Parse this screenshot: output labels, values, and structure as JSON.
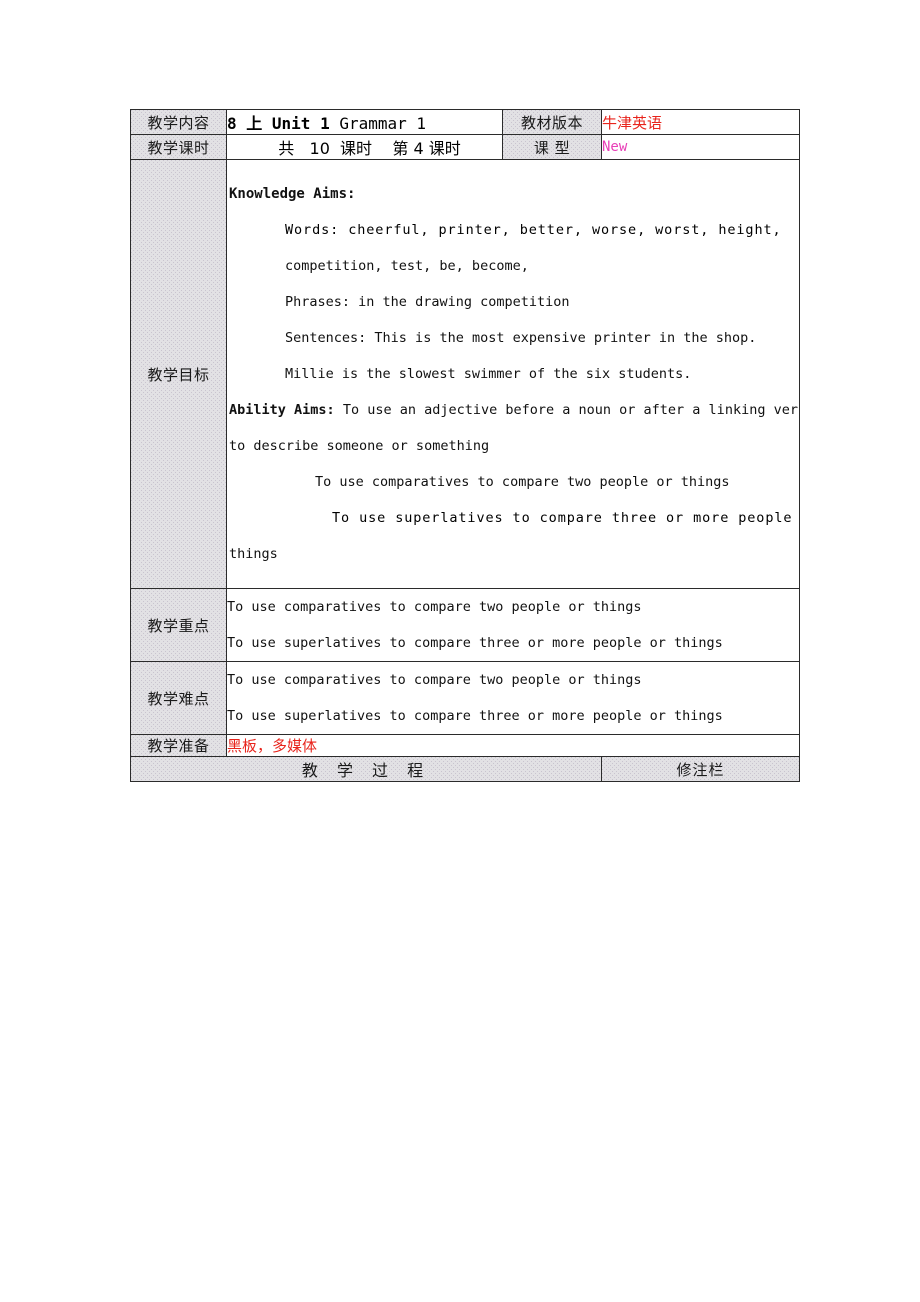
{
  "document": {
    "type": "lesson-plan-table"
  },
  "colors": {
    "shade": "#e2e1e4",
    "border": "#2b2b2b",
    "red": "#e8241c",
    "magenta": "#e83fb7"
  },
  "rows": {
    "content": {
      "label": "教学内容",
      "value_strong": "8 上 Unit 1 ",
      "value_plain": "Grammar 1",
      "textbook_label": "教材版本",
      "textbook_value": "牛津英语"
    },
    "periods": {
      "label": "教学课时",
      "value": "共   10  课时    第 4 课时",
      "lesson_type_label": "课    型",
      "lesson_type_value": "New"
    },
    "objectives": {
      "label": "教学目标",
      "knowledge_heading": "Knowledge Aims:",
      "words_label": "Words:",
      "words_value": "cheerful, printer, better, worse, worst, height,",
      "words_value_2": "competition, test, be, become,",
      "phrases_label": "Phrases:",
      "phrases_value": "in the drawing competition",
      "sentences_label": "Sentences:",
      "sentences_value": "This is the most expensive printer in the shop.",
      "sentences_value_2": "Millie is the slowest swimmer of the six students.",
      "ability_heading": "Ability Aims:",
      "ability_line_1": "To use an adjective before a noun or after a linking verb",
      "ability_line_2": "to describe someone or something",
      "ability_line_3": "To use comparatives to compare two people or things",
      "ability_line_4": "To use superlatives to compare three or more people or",
      "ability_line_5": "things"
    },
    "key_points": {
      "label": "教学重点",
      "line_1": "To use comparatives to compare two people or things",
      "line_2": "To use superlatives to compare three or more people or things"
    },
    "difficult_points": {
      "label": "教学难点",
      "line_1": "To use comparatives to compare two people or things",
      "line_2": "To use superlatives to compare three or more people or things"
    },
    "preparation": {
      "label": "教学准备",
      "value": "黑板，多媒体"
    },
    "process_header": {
      "process_label": "教 学 过 程",
      "notes_label": "修注栏"
    }
  }
}
